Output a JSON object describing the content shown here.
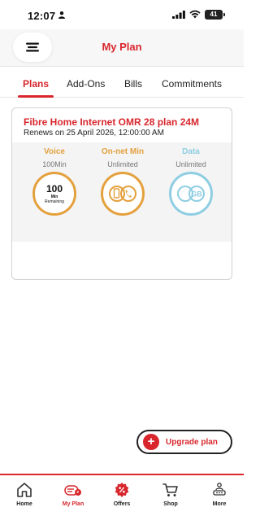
{
  "status": {
    "time": "12:07",
    "battery": "41"
  },
  "header": {
    "title": "My Plan"
  },
  "tabs": [
    {
      "label": "Plans",
      "active": true
    },
    {
      "label": "Add-Ons",
      "active": false
    },
    {
      "label": "Bills",
      "active": false
    },
    {
      "label": "Commitments",
      "active": false
    }
  ],
  "plan": {
    "name": "Fibre Home Internet OMR 28 plan 24M",
    "renews": "Renews on 25 April 2026, 12:00:00 AM",
    "usage": [
      {
        "title": "Voice",
        "subtitle": "100Min",
        "ring_value": "100",
        "ring_unit": "Min",
        "ring_label": "Remaining",
        "color": "#e4a03c",
        "icon": "text"
      },
      {
        "title": "On-net Min",
        "subtitle": "Unlimited",
        "color": "#e4a03c",
        "icon": "phone-infinity-icon"
      },
      {
        "title": "Data",
        "subtitle": "Unlimited",
        "ring_value": "GB",
        "color": "#8ecde2",
        "icon": "infinity-gb-icon"
      }
    ]
  },
  "upgrade": {
    "label": "Upgrade plan"
  },
  "nav": [
    {
      "label": "Home",
      "icon": "home-icon",
      "active": false
    },
    {
      "label": "My Plan",
      "icon": "plan-icon",
      "active": true
    },
    {
      "label": "Offers",
      "icon": "offers-icon",
      "active": false
    },
    {
      "label": "Shop",
      "icon": "cart-icon",
      "active": false
    },
    {
      "label": "More",
      "icon": "more-icon",
      "active": false
    }
  ],
  "colors": {
    "brand": "#d8262c",
    "orange": "#e4a03c",
    "blue": "#8ecde2"
  }
}
